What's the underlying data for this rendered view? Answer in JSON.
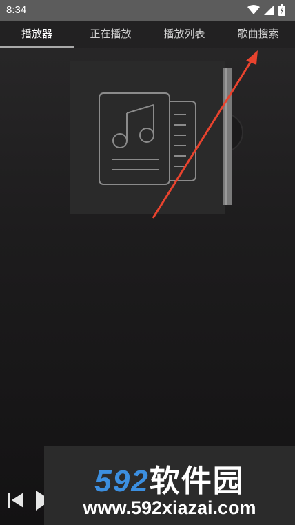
{
  "status_bar": {
    "time": "8:34"
  },
  "tabs": [
    {
      "label": "播放器",
      "active": true
    },
    {
      "label": "正在播放",
      "active": false
    },
    {
      "label": "播放列表",
      "active": false
    },
    {
      "label": "歌曲搜索",
      "active": false
    }
  ],
  "icons": {
    "album": "music-document-icon",
    "previous": "skip-previous-icon",
    "play": "play-icon",
    "wifi": "wifi-icon",
    "signal": "signal-icon",
    "battery": "battery-icon"
  },
  "colors": {
    "arrow": "#e8432e",
    "watermark_number": "#3c8fe0"
  },
  "watermark": {
    "number": "592",
    "name": "软件园",
    "url": "www.592xiazai.com"
  }
}
